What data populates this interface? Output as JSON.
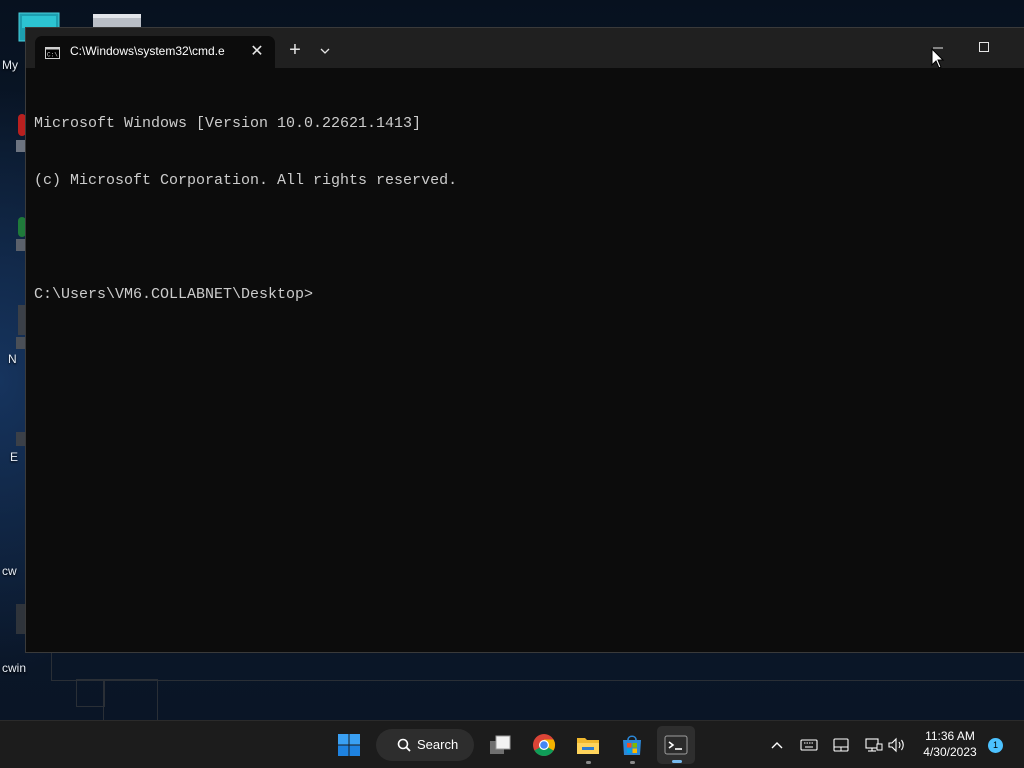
{
  "desktop": {
    "labels": {
      "my_computer": "My",
      "n_label": "N",
      "e_label": "E",
      "cwin_1": "cw",
      "cwin_2": "cwin"
    }
  },
  "terminal": {
    "tab": {
      "title": "C:\\Windows\\system32\\cmd.e",
      "icon": "cmd-icon"
    },
    "new_tab_label": "+",
    "close_tab_label": "✕",
    "console_lines": [
      "Microsoft Windows [Version 10.0.22621.1413]",
      "(c) Microsoft Corporation. All rights reserved.",
      "",
      "C:\\Users\\VM6.COLLABNET\\Desktop>"
    ]
  },
  "taskbar": {
    "search_label": "Search",
    "apps": [
      "start-icon",
      "task-view-icon",
      "chrome-icon",
      "file-explorer-icon",
      "microsoft-store-icon",
      "terminal-icon"
    ],
    "tray": [
      "chevron-up-icon",
      "keyboard-icon",
      "touchpad-icon",
      "network-icon",
      "volume-icon"
    ],
    "time": "11:36 AM",
    "date": "4/30/2023",
    "notification_count": "1"
  },
  "colors": {
    "accent": "#76b9ed",
    "terminal_bg": "#0c0c0c",
    "titlebar_bg": "#202020",
    "taskbar_bg": "#1c1c1c"
  }
}
